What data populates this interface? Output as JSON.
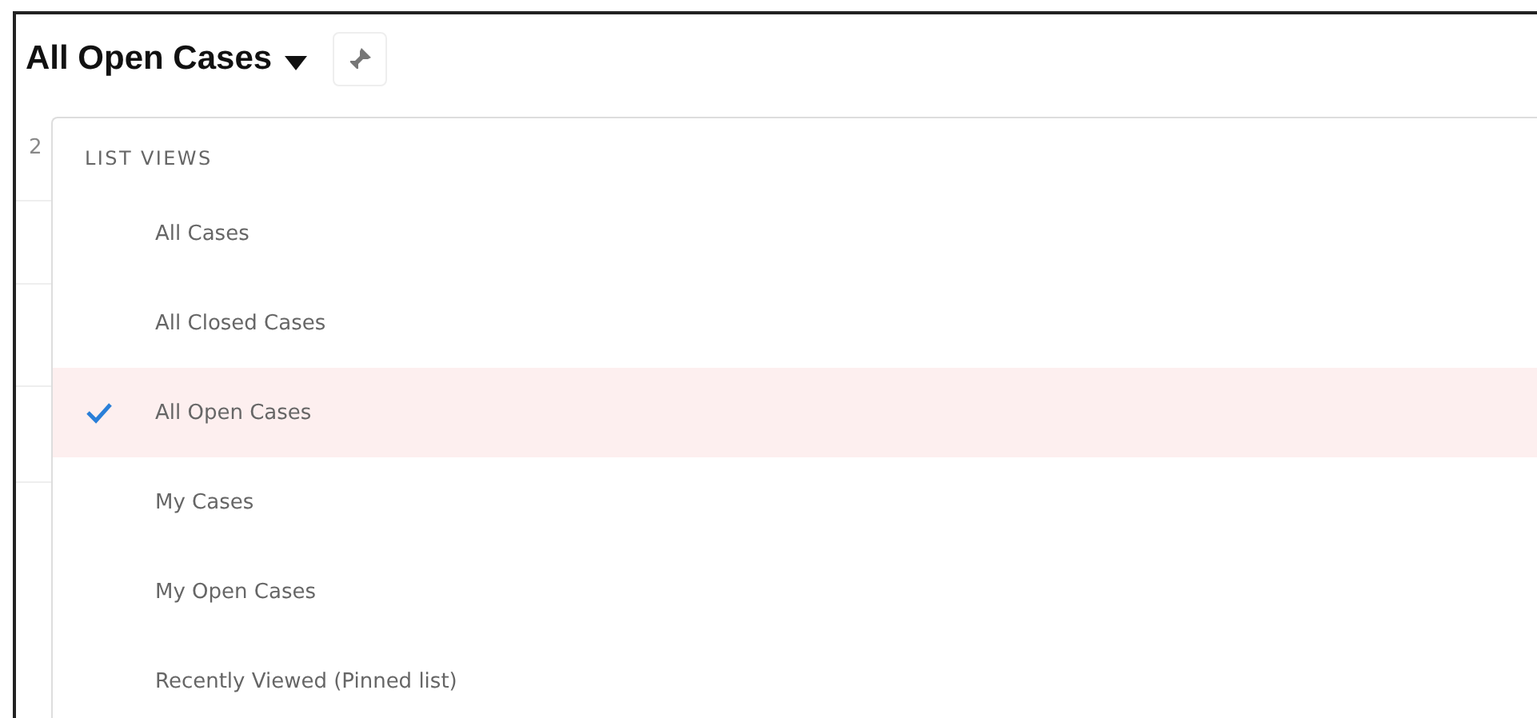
{
  "header": {
    "title": "All Open Cases"
  },
  "background_list": {
    "count_fragment": "2"
  },
  "dropdown": {
    "section_label": "LIST VIEWS",
    "items": [
      {
        "label": "All Cases",
        "selected": false
      },
      {
        "label": "All Closed Cases",
        "selected": false
      },
      {
        "label": "All Open Cases",
        "selected": true
      },
      {
        "label": "My Cases",
        "selected": false
      },
      {
        "label": "My Open Cases",
        "selected": false
      },
      {
        "label": "Recently Viewed (Pinned list)",
        "selected": false
      }
    ]
  }
}
